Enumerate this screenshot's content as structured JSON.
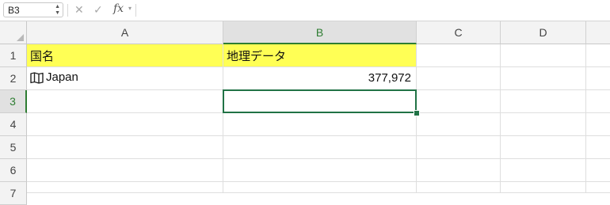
{
  "formula_bar": {
    "name_box": "B3",
    "fx_label": "fx",
    "formula": ""
  },
  "columns": [
    "A",
    "B",
    "C",
    "D"
  ],
  "rows": [
    "1",
    "2",
    "3",
    "4",
    "5",
    "6",
    "7"
  ],
  "cells": {
    "A1": "国名",
    "B1": "地理データ",
    "A2": "Japan",
    "B2": "377,972"
  },
  "selected_cell": "B3",
  "colors": {
    "header_fill": "#ffff55",
    "selection": "#217346"
  },
  "icons": {
    "A2": "map-icon"
  }
}
